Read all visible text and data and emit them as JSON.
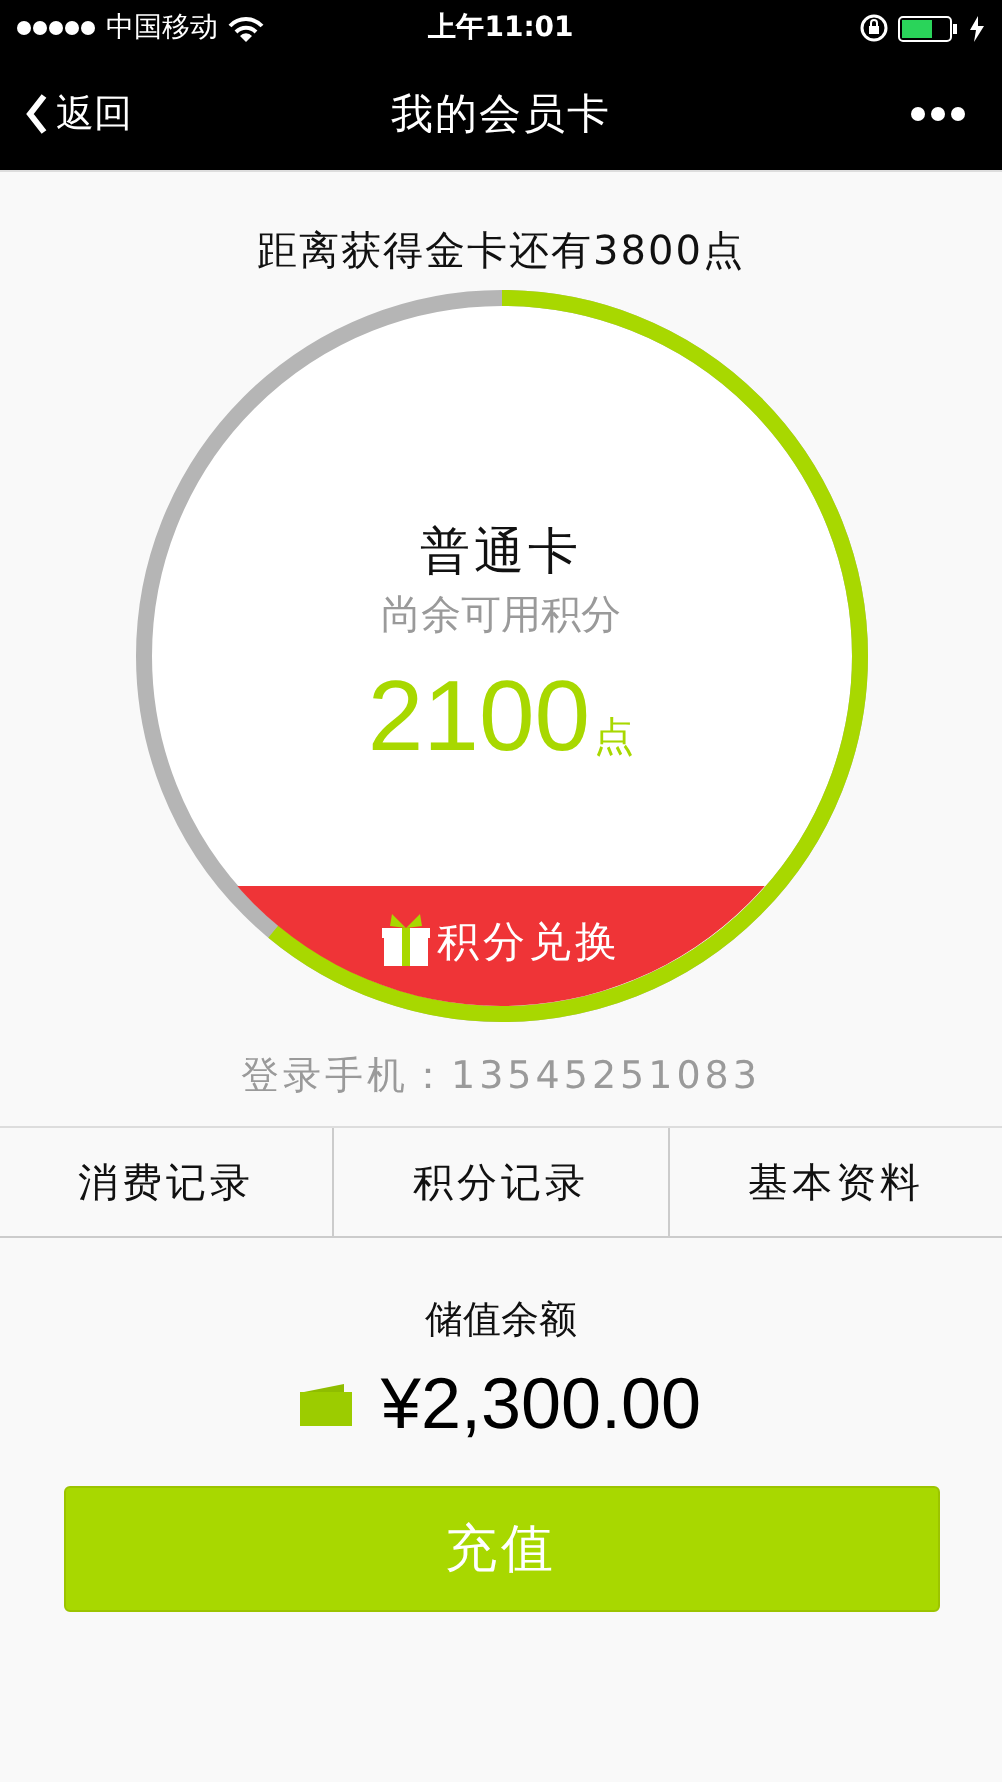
{
  "status_bar": {
    "carrier": "中国移动",
    "time": "上午11:01"
  },
  "nav": {
    "back": "返回",
    "title": "我的会员卡"
  },
  "progress": {
    "caption": "距离获得金卡还有3800点",
    "level": 0.61
  },
  "card": {
    "tier": "普通卡",
    "label": "尚余可用积分",
    "points": "2100",
    "unit": "点",
    "redeem": "积分兑换"
  },
  "phone": "登录手机：13545251083",
  "tabs": [
    {
      "label": "消费记录"
    },
    {
      "label": "积分记录"
    },
    {
      "label": "基本资料"
    }
  ],
  "balance": {
    "label": "储值余额",
    "amount": "¥2,300.00"
  },
  "action": {
    "label": "充值"
  }
}
